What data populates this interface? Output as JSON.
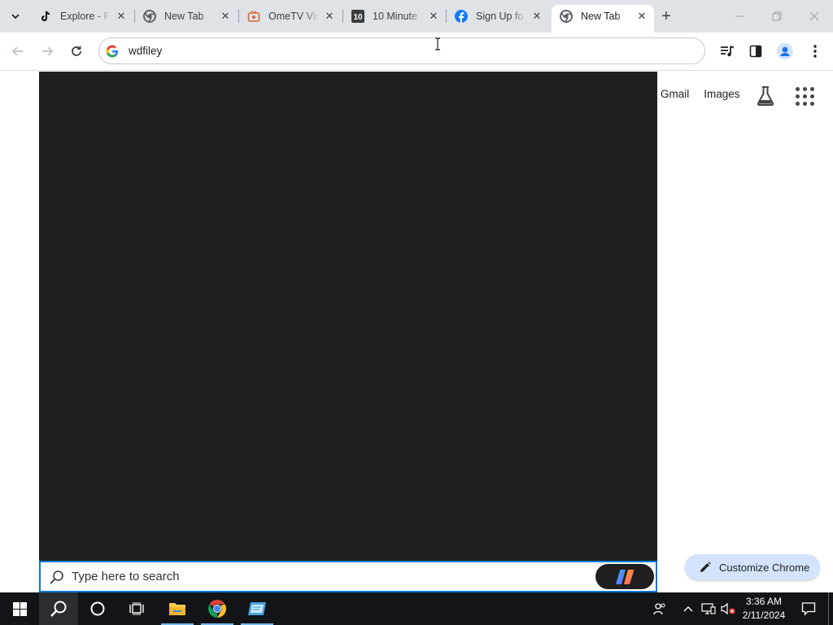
{
  "browser": {
    "tabs": [
      {
        "title": "Explore - F",
        "favicon": "tiktok-icon",
        "active": false
      },
      {
        "title": "New Tab",
        "favicon": "chrome-icon",
        "active": false
      },
      {
        "title": "OmeTV Vid",
        "favicon": "ometv-icon",
        "active": false
      },
      {
        "title": "10 Minute",
        "favicon": "ten-minute-icon",
        "active": false
      },
      {
        "title": "Sign Up fo",
        "favicon": "facebook-icon",
        "active": false
      },
      {
        "title": "New Tab",
        "favicon": "chrome-icon",
        "active": true
      }
    ],
    "new_tab_symbol": "+",
    "omnibox": {
      "value": "wdfiley",
      "icon": "google-g-icon"
    }
  },
  "page": {
    "top_links": {
      "gmail": "Gmail",
      "images": "Images"
    },
    "customize_label": "Customize Chrome"
  },
  "windows_search": {
    "placeholder": "Type here to search",
    "value": ""
  },
  "taskbar": {
    "clock": {
      "time": "3:36 AM",
      "date": "2/11/2024"
    }
  },
  "colors": {
    "tabstrip_bg": "#dfe3e7",
    "dark_panel": "#202020",
    "customize_bg": "#d3e3fd",
    "taskbar_bg": "#121417",
    "search_border": "#0078d4"
  }
}
